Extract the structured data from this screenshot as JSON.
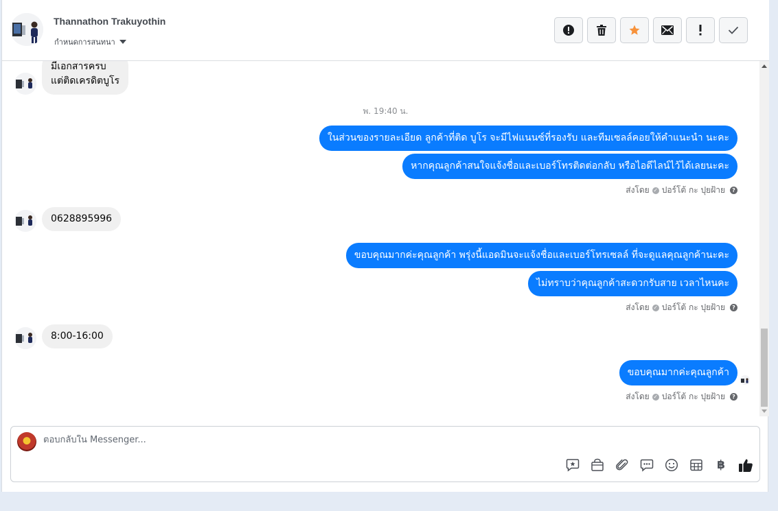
{
  "header": {
    "contact_name": "Thannathon Trakuyothin",
    "assign_label": "กำหนดการสนทนา",
    "toolbar": [
      {
        "name": "spam-button",
        "icon": "exclamation-circle-icon"
      },
      {
        "name": "delete-button",
        "icon": "trash-icon"
      },
      {
        "name": "star-button",
        "icon": "star-icon"
      },
      {
        "name": "mark-unread-button",
        "icon": "envelope-icon"
      },
      {
        "name": "follow-up-button",
        "icon": "exclamation-icon"
      },
      {
        "name": "mark-done-button",
        "icon": "check-icon"
      }
    ]
  },
  "thread": {
    "m1_line1": "มีเอกสารครบ",
    "m1_line2": "แต่ติดเครดิตบูโร",
    "timestamp": "พ. 19:40 น.",
    "m2": "ในส่วนของรายละเอียด ลูกค้าที่ติด บูโร จะมีไฟแนนซ์ที่รองรับ และทีมเซลล์คอยให้คำแนะนำ นะคะ",
    "m3": "หากคุณลูกค้าสนใจแจ้งชื่อและเบอร์โทรติดต่อกลับ หรือไอดีไลน์ไว้ได้เลยนะคะ",
    "m4": "0628895996",
    "m5": "ขอบคุณมากค่ะคุณลูกค้า พรุ่งนี้แอดมินจะแจ้งชื่อและเบอร์โทรเซลล์ ที่จะดูแลคุณลูกค้านะคะ",
    "m6": "ไม่ทราบว่าคุณลูกค้าสะดวกรับสาย เวลาไหนคะ",
    "m7": "8:00-16:00",
    "m8": "ขอบคุณมากค่ะคุณลูกค้า",
    "sent_by_prefix": "ส่งโดย",
    "sent_by_name": "ปอร์โต้ กะ ปุยฝ้าย"
  },
  "composer": {
    "placeholder": "ตอบกลับใน Messenger...",
    "tools": [
      "saved-reply-icon",
      "shop-icon",
      "attachment-icon",
      "chat-bubble-icon",
      "emoji-icon",
      "table-icon",
      "baht-icon",
      "like-icon"
    ],
    "baht_symbol": "฿"
  },
  "colors": {
    "outgoing_bubble": "#0a7cff",
    "incoming_bubble": "#f0f0f0",
    "star": "#f7923b"
  }
}
